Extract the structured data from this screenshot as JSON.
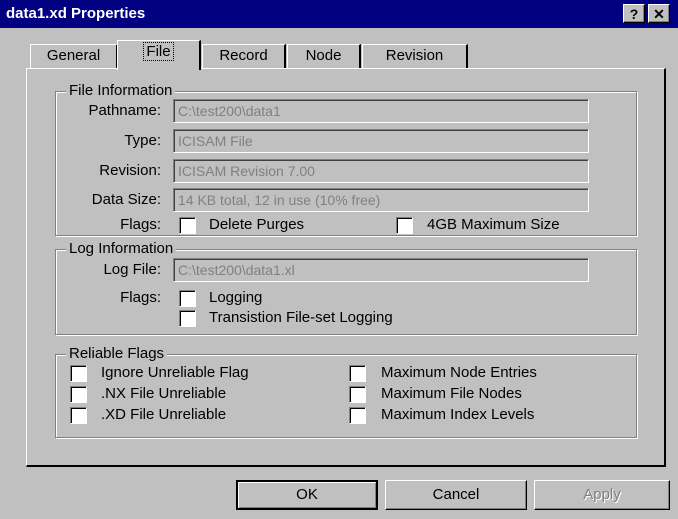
{
  "window": {
    "title": "data1.xd Properties",
    "help_glyph": "?",
    "close_glyph": "✕"
  },
  "tabs": [
    {
      "label": "General",
      "active": false
    },
    {
      "label": "File",
      "active": true
    },
    {
      "label": "Record",
      "active": false
    },
    {
      "label": "Node",
      "active": false
    },
    {
      "label": "Revision",
      "active": false
    }
  ],
  "file_info": {
    "group_title": "File Information",
    "pathname_label": "Pathname:",
    "pathname_value": "C:\\test200\\data1",
    "type_label": "Type:",
    "type_value": "ICISAM File",
    "revision_label": "Revision:",
    "revision_value": "ICISAM Revision  7.00",
    "datasize_label": "Data Size:",
    "datasize_value": "14 KB total, 12 in use (10% free)",
    "flags_label": "Flags:",
    "delete_purges": {
      "label": "Delete Purges",
      "checked": false
    },
    "max_size_4gb": {
      "label": "4GB Maximum Size",
      "checked": false
    }
  },
  "log_info": {
    "group_title": "Log Information",
    "logfile_label": "Log File:",
    "logfile_value": "C:\\test200\\data1.xl",
    "flags_label": "Flags:",
    "logging": {
      "label": "Logging",
      "checked": false
    },
    "transition_logging": {
      "label": "Transistion File-set Logging",
      "checked": false
    }
  },
  "reliable_flags": {
    "group_title": "Reliable Flags",
    "left": [
      {
        "label": "Ignore Unreliable Flag",
        "checked": false
      },
      {
        "label": ".NX File Unreliable",
        "checked": false
      },
      {
        "label": ".XD File Unreliable",
        "checked": false
      }
    ],
    "right": [
      {
        "label": "Maximum Node Entries",
        "checked": false
      },
      {
        "label": "Maximum File Nodes",
        "checked": false
      },
      {
        "label": "Maximum Index Levels",
        "checked": false
      }
    ]
  },
  "buttons": {
    "ok": "OK",
    "cancel": "Cancel",
    "apply": "Apply"
  },
  "colors": {
    "titlebar": "#000080",
    "face": "#c0c0c0",
    "disabled_text": "#808080"
  }
}
